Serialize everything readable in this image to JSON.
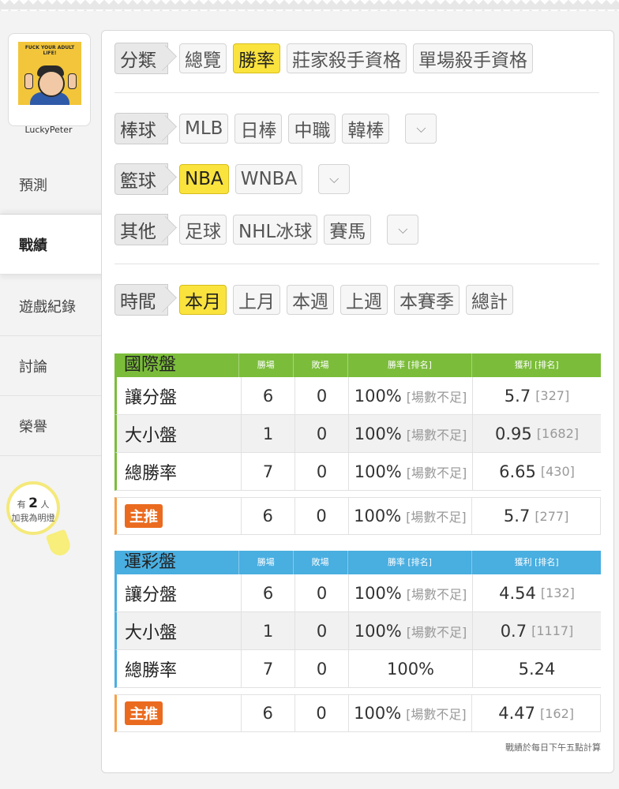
{
  "user": {
    "name": "LuckyPeter",
    "avatar_text": "FUCK YOUR ADULT LIFE!"
  },
  "nav": [
    {
      "label": "預測"
    },
    {
      "label": "戰績"
    },
    {
      "label": "遊戲紀錄"
    },
    {
      "label": "討論"
    },
    {
      "label": "榮譽"
    }
  ],
  "fans": {
    "prefix": "有",
    "count": "2",
    "suffix": "人",
    "line2": "加我為明燈"
  },
  "filters": {
    "category": {
      "label": "分類",
      "options": [
        "總覽",
        "勝率",
        "莊家殺手資格",
        "單場殺手資格"
      ],
      "active": "勝率"
    },
    "baseball": {
      "label": "棒球",
      "options": [
        "MLB",
        "日棒",
        "中職",
        "韓棒"
      ]
    },
    "basketball": {
      "label": "籃球",
      "options": [
        "NBA",
        "WNBA"
      ],
      "active": "NBA"
    },
    "other": {
      "label": "其他",
      "options": [
        "足球",
        "NHL冰球",
        "賽馬"
      ]
    },
    "time": {
      "label": "時間",
      "options": [
        "本月",
        "上月",
        "本週",
        "上週",
        "本賽季",
        "總計"
      ],
      "active": "本月"
    }
  },
  "tables": [
    {
      "title": "國際盤",
      "headers": [
        "勝場",
        "敗場",
        "勝率 [排名]",
        "獲利 [排名]"
      ],
      "rows": [
        {
          "name": "讓分盤",
          "win": "6",
          "loss": "0",
          "rate": "100%",
          "rate_rank": "[場數不足]",
          "profit": "5.7",
          "profit_rank": "[327]"
        },
        {
          "name": "大小盤",
          "win": "1",
          "loss": "0",
          "rate": "100%",
          "rate_rank": "[場數不足]",
          "profit": "0.95",
          "profit_rank": "[1682]"
        },
        {
          "name": "總勝率",
          "win": "7",
          "loss": "0",
          "rate": "100%",
          "rate_rank": "[場數不足]",
          "profit": "6.65",
          "profit_rank": "[430]"
        }
      ],
      "featured": {
        "badge": "主推",
        "win": "6",
        "loss": "0",
        "rate": "100%",
        "rate_rank": "[場數不足]",
        "profit": "5.7",
        "profit_rank": "[277]"
      }
    },
    {
      "title": "運彩盤",
      "headers": [
        "勝場",
        "敗場",
        "勝率 [排名]",
        "獲利 [排名]"
      ],
      "rows": [
        {
          "name": "讓分盤",
          "win": "6",
          "loss": "0",
          "rate": "100%",
          "rate_rank": "[場數不足]",
          "profit": "4.54",
          "profit_rank": "[132]"
        },
        {
          "name": "大小盤",
          "win": "1",
          "loss": "0",
          "rate": "100%",
          "rate_rank": "[場數不足]",
          "profit": "0.7",
          "profit_rank": "[1117]"
        },
        {
          "name": "總勝率",
          "win": "7",
          "loss": "0",
          "rate": "100%",
          "rate_rank": "",
          "profit": "5.24",
          "profit_rank": ""
        }
      ],
      "featured": {
        "badge": "主推",
        "win": "6",
        "loss": "0",
        "rate": "100%",
        "rate_rank": "[場數不足]",
        "profit": "4.47",
        "profit_rank": "[162]"
      }
    }
  ],
  "footnote": "戰績於每日下午五點計算",
  "colors": {
    "accent_yellow": "#fbe33d",
    "intl_green": "#7bbd3a",
    "sport_blue": "#49aee0",
    "badge_orange": "#ea6b1f"
  }
}
